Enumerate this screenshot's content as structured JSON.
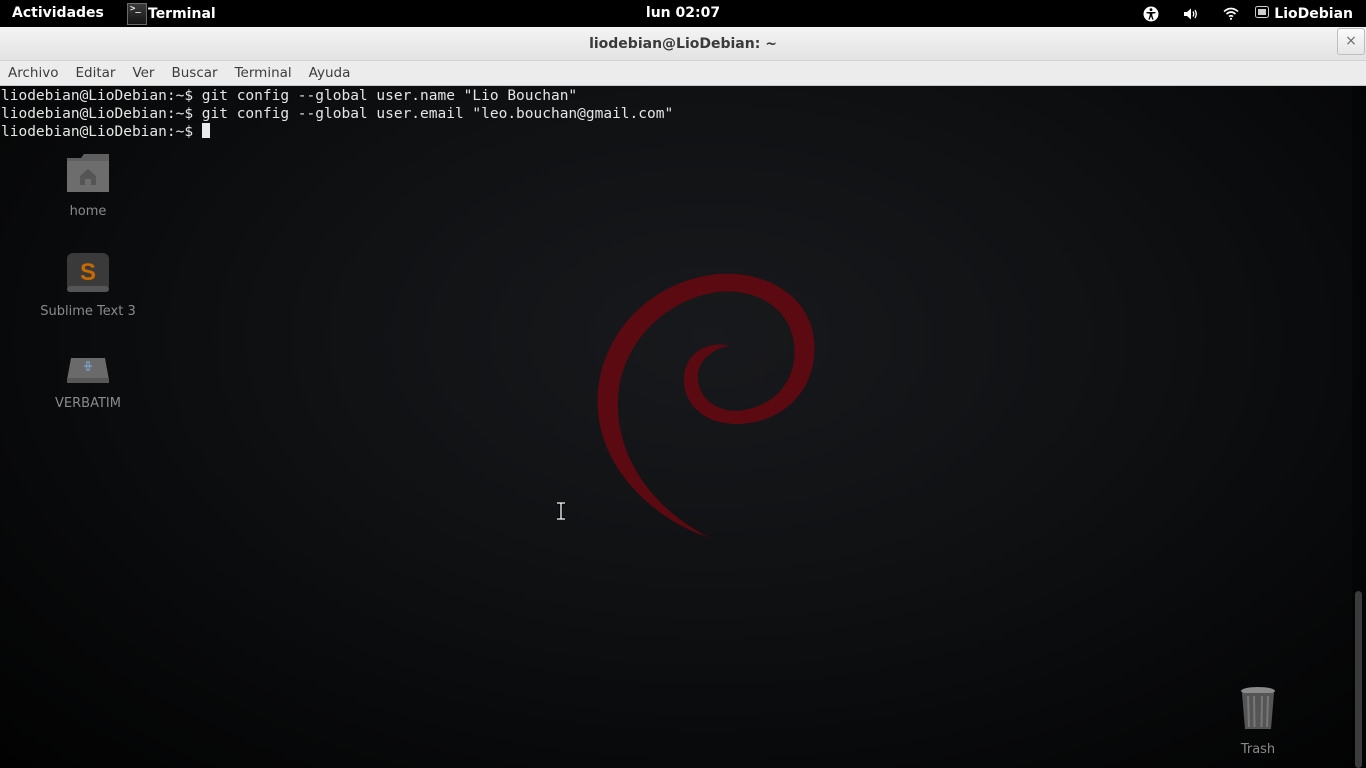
{
  "topbar": {
    "activities": "Actividades",
    "app_icon_text": ">_",
    "app_name": "Terminal",
    "clock": "lun 02:07",
    "user": "LioDebian",
    "icons": [
      "accessibility-icon",
      "volume-icon",
      "wifi-icon",
      "user-status-icon"
    ]
  },
  "window": {
    "title": "liodebian@LioDebian: ~",
    "close_label": "×",
    "menu": [
      "Archivo",
      "Editar",
      "Ver",
      "Buscar",
      "Terminal",
      "Ayuda"
    ]
  },
  "terminal": {
    "lines": [
      "liodebian@LioDebian:~$ git config --global user.name \"Lio Bouchan\"",
      "liodebian@LioDebian:~$ git config --global user.email \"leo.bouchan@gmail.com\"",
      "liodebian@LioDebian:~$ "
    ]
  },
  "desktop": {
    "icons": [
      {
        "label": "home",
        "icon": "folder-home-icon"
      },
      {
        "label": "Sublime Text 3",
        "icon": "sublime-text-icon"
      },
      {
        "label": "VERBATIM",
        "icon": "usb-drive-icon"
      },
      {
        "label": "Trash",
        "icon": "trash-icon"
      }
    ]
  },
  "colors": {
    "swirl": "#5a0a10",
    "terminal_text": "#e6e6e6",
    "titlebar": "#ececec"
  }
}
